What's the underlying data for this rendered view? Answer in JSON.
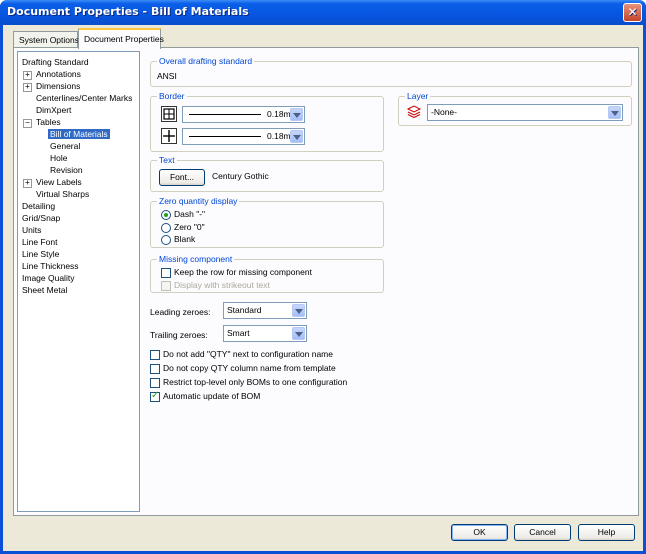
{
  "window": {
    "title": "Document Properties - Bill of Materials"
  },
  "tabs": [
    {
      "label": "System Options"
    },
    {
      "label": "Document Properties"
    }
  ],
  "tree": [
    {
      "label": "Drafting Standard"
    },
    {
      "label": "Annotations"
    },
    {
      "label": "Dimensions"
    },
    {
      "label": "Centerlines/Center Marks"
    },
    {
      "label": "DimXpert"
    },
    {
      "label": "Tables"
    },
    {
      "label": "Bill of Materials"
    },
    {
      "label": "General"
    },
    {
      "label": "Hole"
    },
    {
      "label": "Revision"
    },
    {
      "label": "View Labels"
    },
    {
      "label": "Virtual Sharps"
    },
    {
      "label": "Detailing"
    },
    {
      "label": "Grid/Snap"
    },
    {
      "label": "Units"
    },
    {
      "label": "Line Font"
    },
    {
      "label": "Line Style"
    },
    {
      "label": "Line Thickness"
    },
    {
      "label": "Image Quality"
    },
    {
      "label": "Sheet Metal"
    }
  ],
  "drafting": {
    "title": "Overall drafting standard",
    "value": "ANSI"
  },
  "border": {
    "title": "Border",
    "outer_thickness": "0.18mm",
    "inner_thickness": "0.18mm"
  },
  "layer": {
    "title": "Layer",
    "value": "-None-"
  },
  "text": {
    "title": "Text",
    "font_button": "Font...",
    "font_name": "Century Gothic"
  },
  "zero_qty": {
    "title": "Zero quantity display",
    "options": [
      "Dash \"-\"",
      "Zero \"0\"",
      "Blank"
    ],
    "selected": "Dash \"-\""
  },
  "missing": {
    "title": "Missing component",
    "keep_row": "Keep the row for missing component",
    "strikeout": "Display with strikeout text"
  },
  "leading": {
    "label": "Leading zeroes:",
    "value": "Standard"
  },
  "trailing": {
    "label": "Trailing zeroes:",
    "value": "Smart"
  },
  "options": [
    {
      "label": "Do not add \"QTY\" next to configuration name",
      "checked": false
    },
    {
      "label": "Do not copy QTY column name from template",
      "checked": false
    },
    {
      "label": "Restrict top-level only BOMs to one configuration",
      "checked": false
    },
    {
      "label": "Automatic update of BOM",
      "checked": true
    }
  ],
  "buttons": {
    "ok": "OK",
    "cancel": "Cancel",
    "help": "Help"
  },
  "colors": {
    "title_bar": "#0755e0",
    "group_title": "#0046d5",
    "selection": "#316ac5"
  }
}
